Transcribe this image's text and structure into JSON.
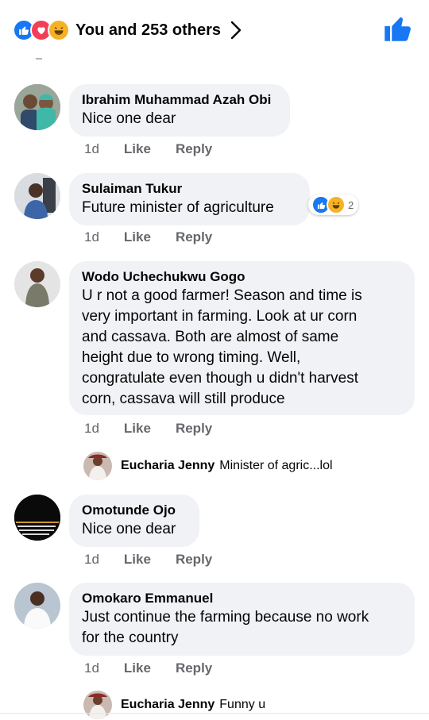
{
  "header": {
    "reaction_summary": "You and 253 others",
    "reaction_icons": [
      "like-icon",
      "love-icon",
      "haha-icon"
    ],
    "like_button_icon": "thumbs-up-icon"
  },
  "colors": {
    "accent": "#1877f2",
    "love": "#f33e58",
    "haha": "#f7b125",
    "bubble": "#f0f2f5",
    "secondary_text": "#65676b"
  },
  "comments": [
    {
      "name": "Ibrahim Muhammad Azah Obi",
      "text": "Nice one dear",
      "time": "1d",
      "like": "Like",
      "reply": "Reply"
    },
    {
      "name": "Sulaiman Tukur",
      "text": "Future minister of agriculture",
      "time": "1d",
      "like": "Like",
      "reply": "Reply",
      "reaction_count": "2"
    },
    {
      "name": "Wodo Uchechukwu Gogo",
      "text": "U r not a good farmer! Season and time is\nvery important in farming. Look at ur corn\nand cassava. Both are almost of same\nheight due to wrong timing. Well,\ncongratulate even though u didn't harvest\ncorn, cassava will still produce",
      "time": "1d",
      "like": "Like",
      "reply": "Reply",
      "reply_preview": {
        "name": "Eucharia Jenny",
        "text": "Minister of agric...lol"
      }
    },
    {
      "name": "Omotunde Ojo",
      "text": "Nice one dear",
      "time": "1d",
      "like": "Like",
      "reply": "Reply"
    },
    {
      "name": "Omokaro Emmanuel",
      "text": "Just continue the farming because no work\nfor the country",
      "time": "1d",
      "like": "Like",
      "reply": "Reply",
      "reply_preview": {
        "name": "Eucharia Jenny",
        "text": "Funny u"
      }
    }
  ]
}
